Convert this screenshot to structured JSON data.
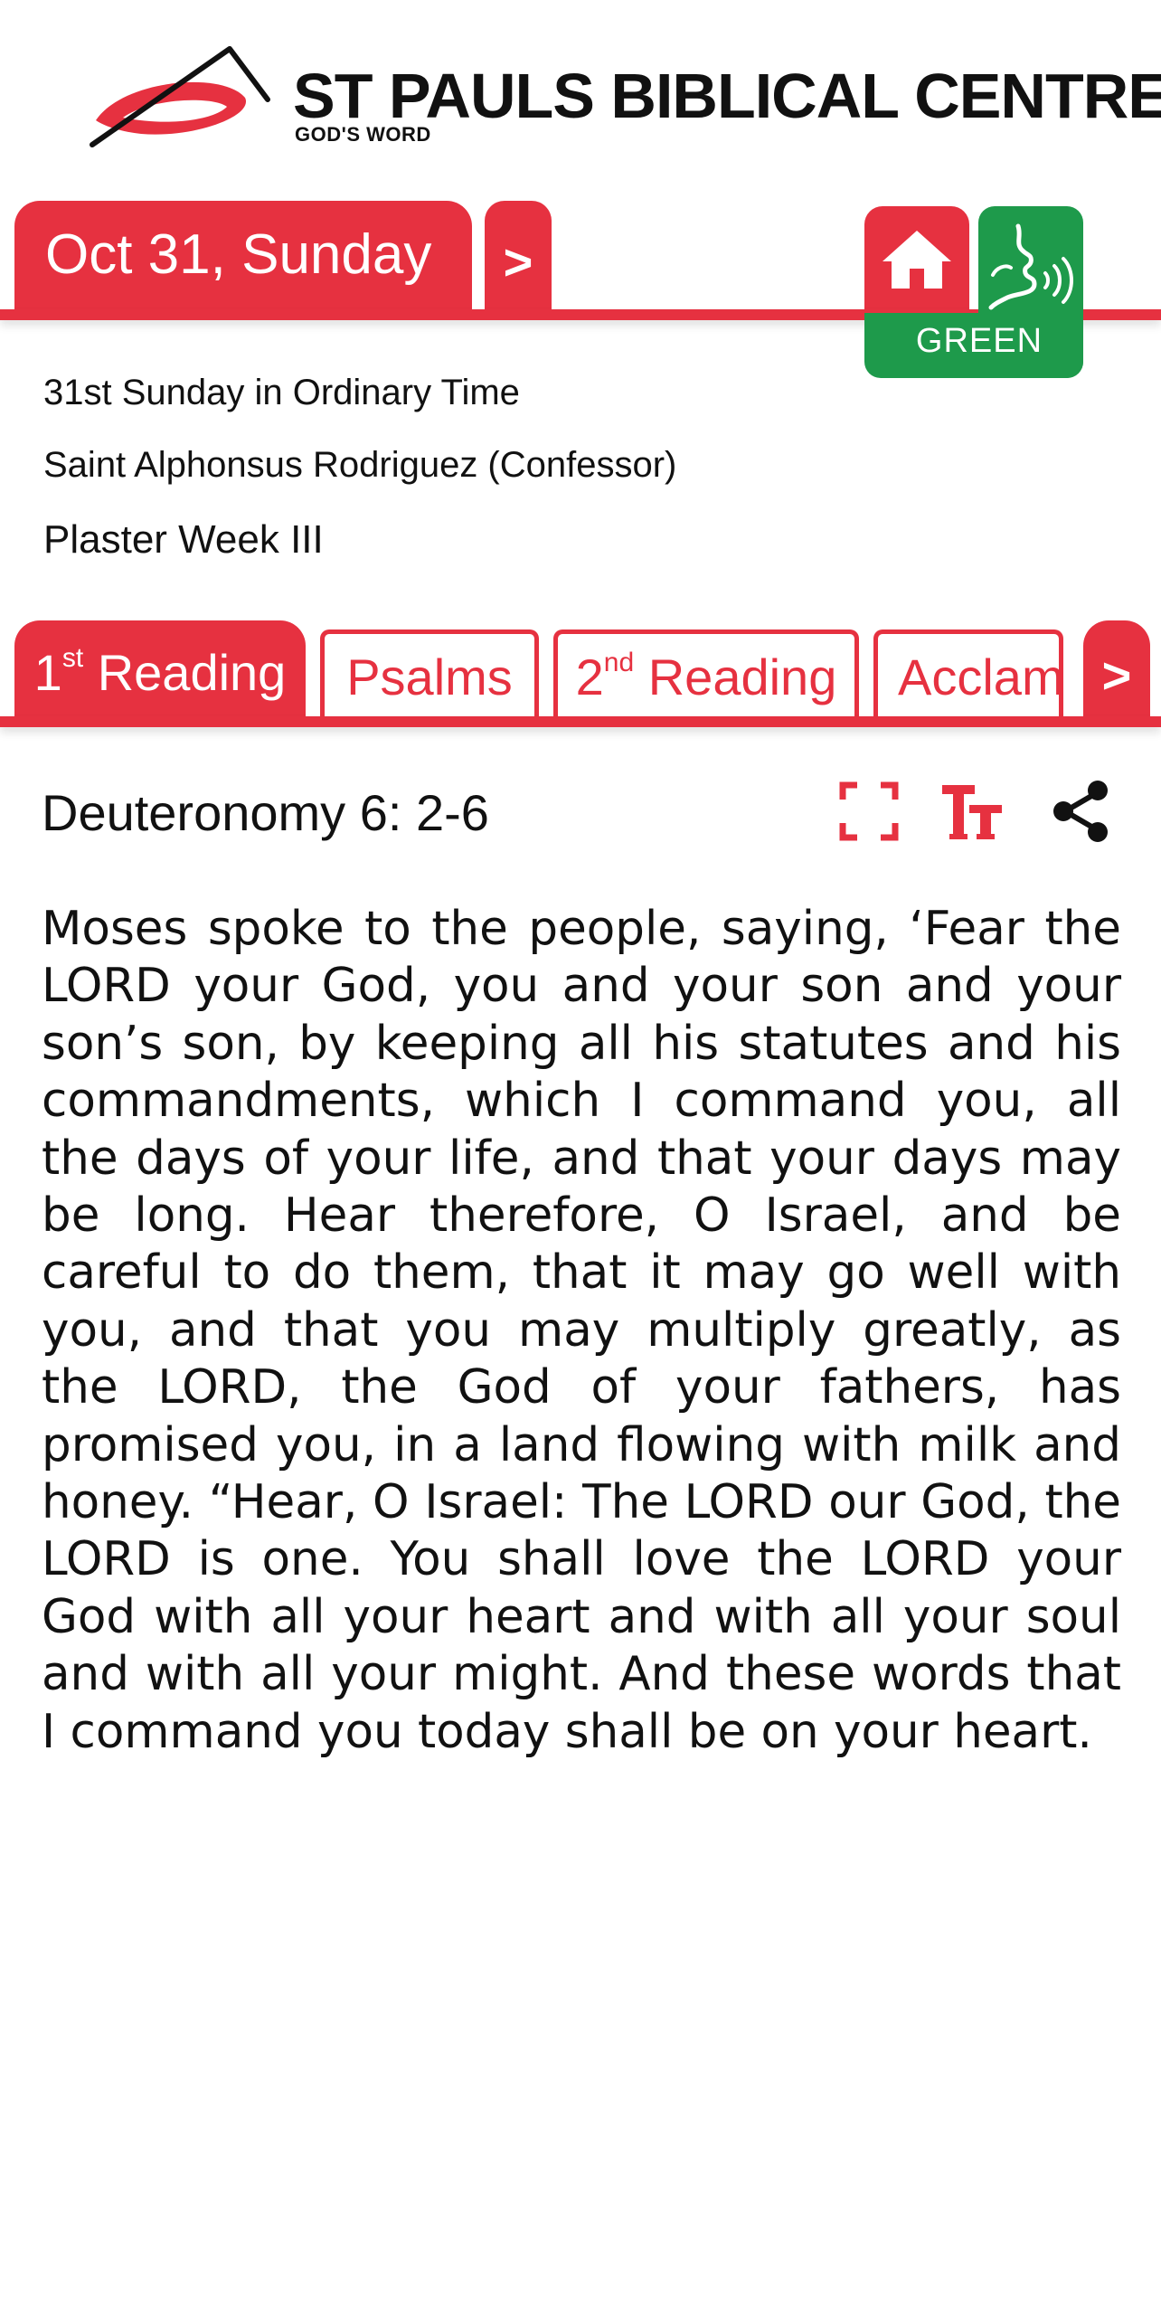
{
  "header": {
    "title": "ST PAULS BIBLICAL CENTRE",
    "subtitle": "GOD'S WORD",
    "logo_icon": "st-pauls-swoosh-logo",
    "colors": {
      "brand_red": "#e63140",
      "black": "#111111"
    }
  },
  "date_bar": {
    "date_label": "Oct 31, Sunday",
    "next_label": ">",
    "home_icon": "home-icon",
    "liturgical_color_icon": "speaking-head-icon",
    "liturgical_color_label": "GREEN",
    "colors": {
      "accent": "#e63140",
      "liturgical": "#1e9a4b"
    }
  },
  "info": {
    "line1": "31st Sunday in Ordinary Time",
    "line2": "Saint Alphonsus Rodriguez (Confessor)",
    "line3": "Plaster Week III"
  },
  "tabs": [
    {
      "label": "1",
      "sup": "st",
      "rest": " Reading",
      "active": true
    },
    {
      "label": "Psalms",
      "active": false
    },
    {
      "label": "2",
      "sup": "nd",
      "rest": " Reading",
      "active": false
    },
    {
      "label": "Acclam",
      "active": false
    }
  ],
  "tabs_next_label": ">",
  "reading": {
    "reference": "Deuteronomy 6: 2-6",
    "tools": [
      "fullscreen-icon",
      "text-size-icon",
      "share-icon"
    ],
    "text": "Moses spoke to the people, saying, ‘Fear the LORD your God, you and your son and your son’s son, by keeping all his statutes and his commandments, which I command you, all the days of your life, and that your days may be long. Hear therefore, O Israel, and be careful to do them, that it may go well with you, and that you may multiply greatly, as the LORD, the God of your fathers, has promised you, in a land flowing with milk and honey. “Hear, O Israel: The LORD our God, the LORD is one. You shall love the LORD your God with all your heart and with all your soul and with all your might. And these words that I command you today shall be on your heart."
  }
}
